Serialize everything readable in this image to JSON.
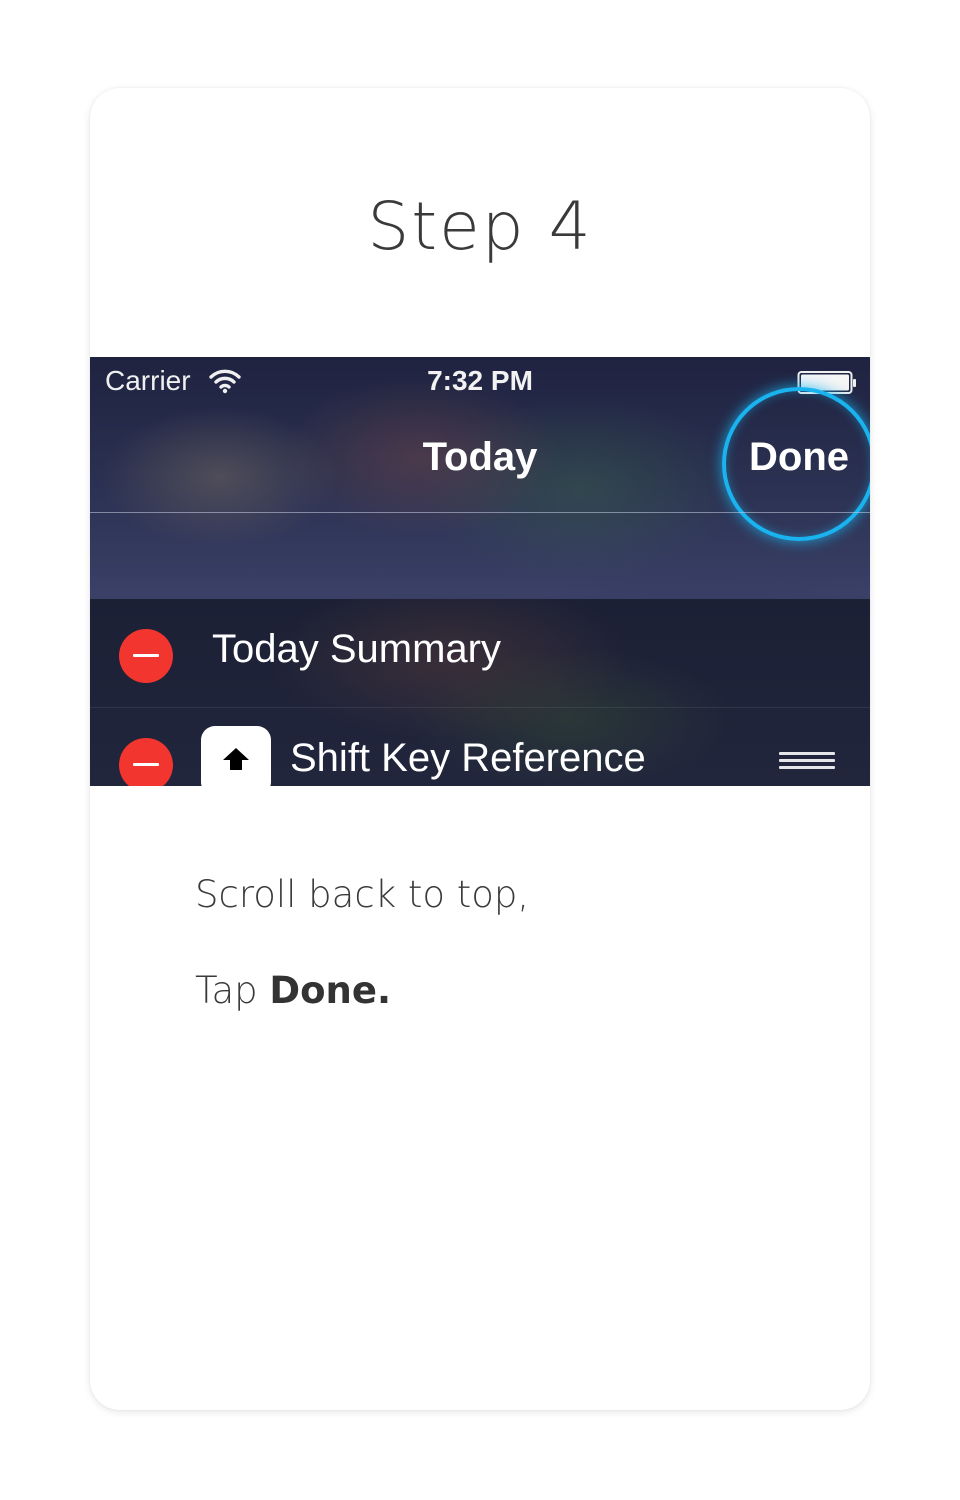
{
  "step": {
    "title": "Step 4"
  },
  "screenshot": {
    "status_bar": {
      "carrier": "Carrier",
      "wifi_icon": "wifi-icon",
      "time": "7:32 PM",
      "battery_icon": "battery-icon"
    },
    "nav": {
      "title": "Today",
      "done_label": "Done"
    },
    "widgets": [
      {
        "label": "Today Summary",
        "icon": "minus-circle-icon"
      },
      {
        "label": "Shift Key Reference",
        "app_icon": "shift-arrow-icon",
        "reorder_icon": "reorder-icon"
      }
    ],
    "highlight_color": "#19b4f0",
    "delete_color": "#f2362f"
  },
  "instructions": {
    "line1": "Scroll back to top,",
    "line2_prefix": "Tap ",
    "line2_bold": "Done",
    "line2_suffix": "."
  }
}
